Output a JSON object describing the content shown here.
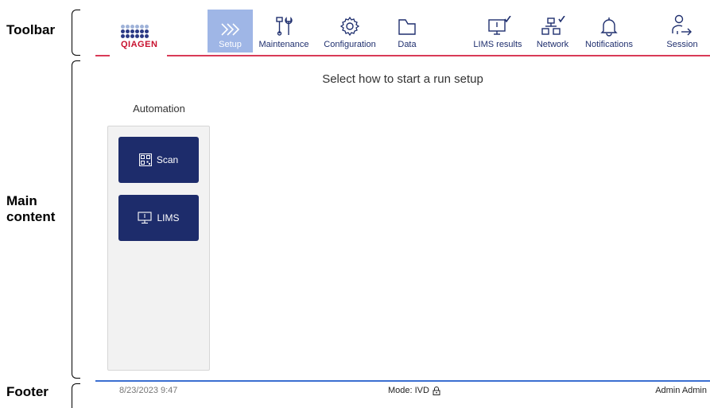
{
  "annotations": {
    "toolbar": "Toolbar",
    "main_content": "Main\ncontent",
    "footer": "Footer"
  },
  "brand": {
    "logo_text": "QIAGEN",
    "accent_color": "#d93a57",
    "primary_color": "#1d2c6b"
  },
  "toolbar": {
    "items": [
      {
        "label": "Setup",
        "icon": "chevrons-right-icon",
        "active": true
      },
      {
        "label": "Maintenance",
        "icon": "tools-icon"
      },
      {
        "label": "Configuration",
        "icon": "gear-icon"
      },
      {
        "label": "Data",
        "icon": "folder-icon"
      },
      {
        "label": "LIMS results",
        "icon": "monitor-check-icon"
      },
      {
        "label": "Network",
        "icon": "network-check-icon"
      },
      {
        "label": "Notifications",
        "icon": "bell-icon"
      },
      {
        "label": "Session",
        "icon": "user-logout-icon"
      }
    ]
  },
  "main": {
    "title": "Select how to start a run setup",
    "column_header": "Automation",
    "buttons": [
      {
        "label": "Scan",
        "icon": "qr-code-icon"
      },
      {
        "label": "LIMS",
        "icon": "monitor-icon"
      }
    ]
  },
  "footer": {
    "datetime": "8/23/2023 9:47",
    "mode": "Mode: IVD",
    "mode_icon": "lock-icon",
    "user": "Admin Admin"
  }
}
